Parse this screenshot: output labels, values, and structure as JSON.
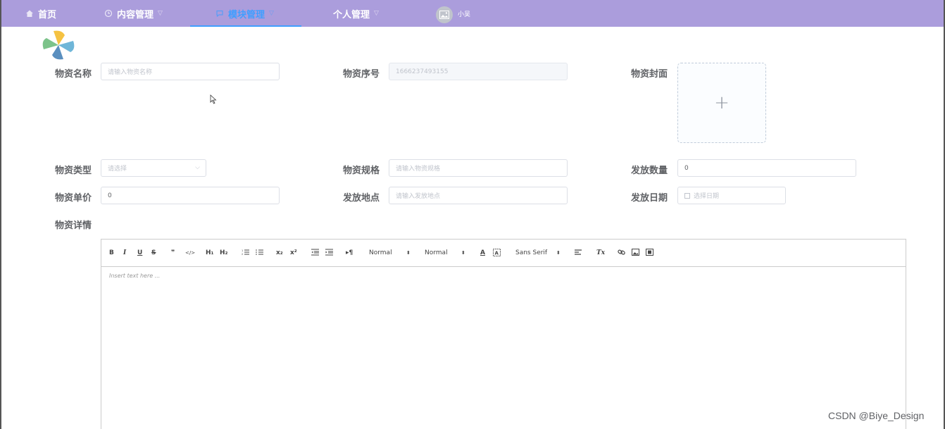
{
  "nav": {
    "home": "首页",
    "content": "内容管理",
    "module": "模块管理",
    "personal": "个人管理",
    "username": "小吴"
  },
  "form": {
    "name": {
      "label": "物资名称",
      "placeholder": "请输入物资名称"
    },
    "serial": {
      "label": "物资序号",
      "value": "1666237493155"
    },
    "cover": {
      "label": "物资封面"
    },
    "type": {
      "label": "物资类型",
      "placeholder": "请选择"
    },
    "spec": {
      "label": "物资规格",
      "placeholder": "请输入物资规格"
    },
    "quantity": {
      "label": "发放数量",
      "value": "0"
    },
    "price": {
      "label": "物资单价",
      "value": "0"
    },
    "location": {
      "label": "发放地点",
      "placeholder": "请输入发放地点"
    },
    "date": {
      "label": "发放日期",
      "placeholder": "选择日期"
    },
    "details": {
      "label": "物资详情"
    }
  },
  "editor": {
    "toolbar": {
      "bold": "B",
      "italic": "I",
      "underline": "U",
      "strike": "S",
      "blockquote": "❞",
      "code": "</>",
      "h1": "H₁",
      "h2": "H₂",
      "subscript": "x₂",
      "superscript": "x²",
      "size_select": "Normal",
      "header_select": "Normal",
      "font_select": "Sans Serif",
      "clean": "Tx"
    },
    "placeholder": "Insert text here ..."
  },
  "watermark": "CSDN @Biye_Design",
  "colors": {
    "nav_bg": "#ab9ddc",
    "active": "#409eff"
  }
}
